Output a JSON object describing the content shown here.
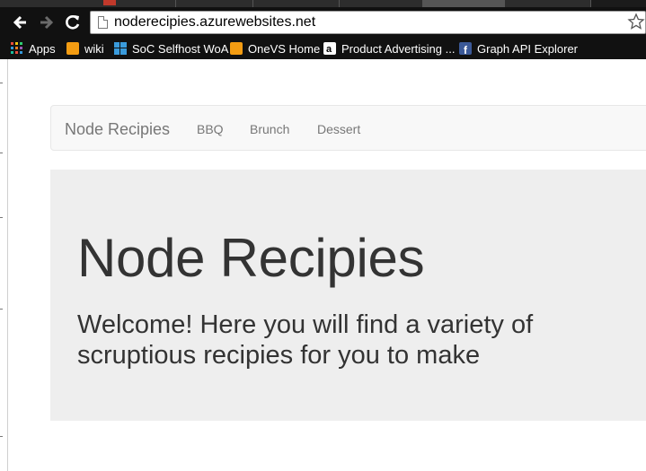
{
  "browser": {
    "url": "noderecipies.azurewebsites.net",
    "bookmarks": [
      {
        "label": "Apps",
        "icon": "apps-grid-icon"
      },
      {
        "label": "wiki",
        "icon": "wiki-icon"
      },
      {
        "label": "SoC Selfhost WoA",
        "icon": "windows-icon"
      },
      {
        "label": "OneVS Home",
        "icon": "onevs-icon"
      },
      {
        "label": "Product Advertising ...",
        "icon": "amazon-icon"
      },
      {
        "label": "Graph API Explorer",
        "icon": "facebook-icon"
      }
    ]
  },
  "navbar": {
    "brand": "Node Recipies",
    "links": [
      "BBQ",
      "Brunch",
      "Dessert"
    ]
  },
  "jumbotron": {
    "title": "Node Recipies",
    "lead": "Welcome! Here you will find a variety of scruptious recipies for you to make"
  },
  "colors": {
    "navbar_bg": "#f8f8f8",
    "jumbotron_bg": "#eeeeee",
    "text": "#333333",
    "nav_text": "#777777"
  }
}
